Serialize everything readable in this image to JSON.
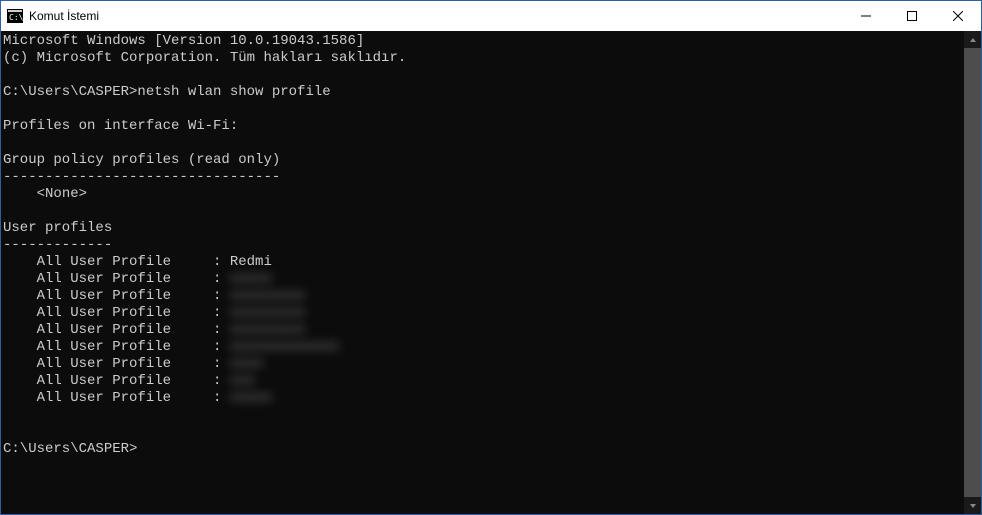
{
  "window": {
    "title": "Komut İstemi"
  },
  "terminal": {
    "line_version": "Microsoft Windows [Version 10.0.19043.1586]",
    "line_copyright": "(c) Microsoft Corporation. Tüm hakları saklıdır.",
    "prompt1_path": "C:\\Users\\CASPER>",
    "prompt1_cmd": "netsh wlan show profile",
    "heading_interface": "Profiles on interface Wi-Fi:",
    "heading_gpp": "Group policy profiles (read only)",
    "gpp_sep": "---------------------------------",
    "gpp_none_indent": "    ",
    "gpp_none": "<None>",
    "heading_user": "User profiles",
    "user_sep": "-------------",
    "profile_indent": "    ",
    "profile_label": "All User Profile",
    "profile_pad": "     : ",
    "profiles": {
      "0": {
        "value": "Redmi",
        "blurred": false
      },
      "1": {
        "value": "xxxxx",
        "blurred": true
      },
      "2": {
        "value": "xxxxxxxxx",
        "blurred": true
      },
      "3": {
        "value": "xxxxxxxxx",
        "blurred": true
      },
      "4": {
        "value": "xxxxxxxxx",
        "blurred": true
      },
      "5": {
        "value": "xxxxxxxxxxxxx",
        "blurred": true
      },
      "6": {
        "value": "xxxx",
        "blurred": true
      },
      "7": {
        "value": "xxx",
        "blurred": true
      },
      "8": {
        "value": "xxxxx",
        "blurred": true
      }
    },
    "prompt2_path": "C:\\Users\\CASPER>"
  }
}
